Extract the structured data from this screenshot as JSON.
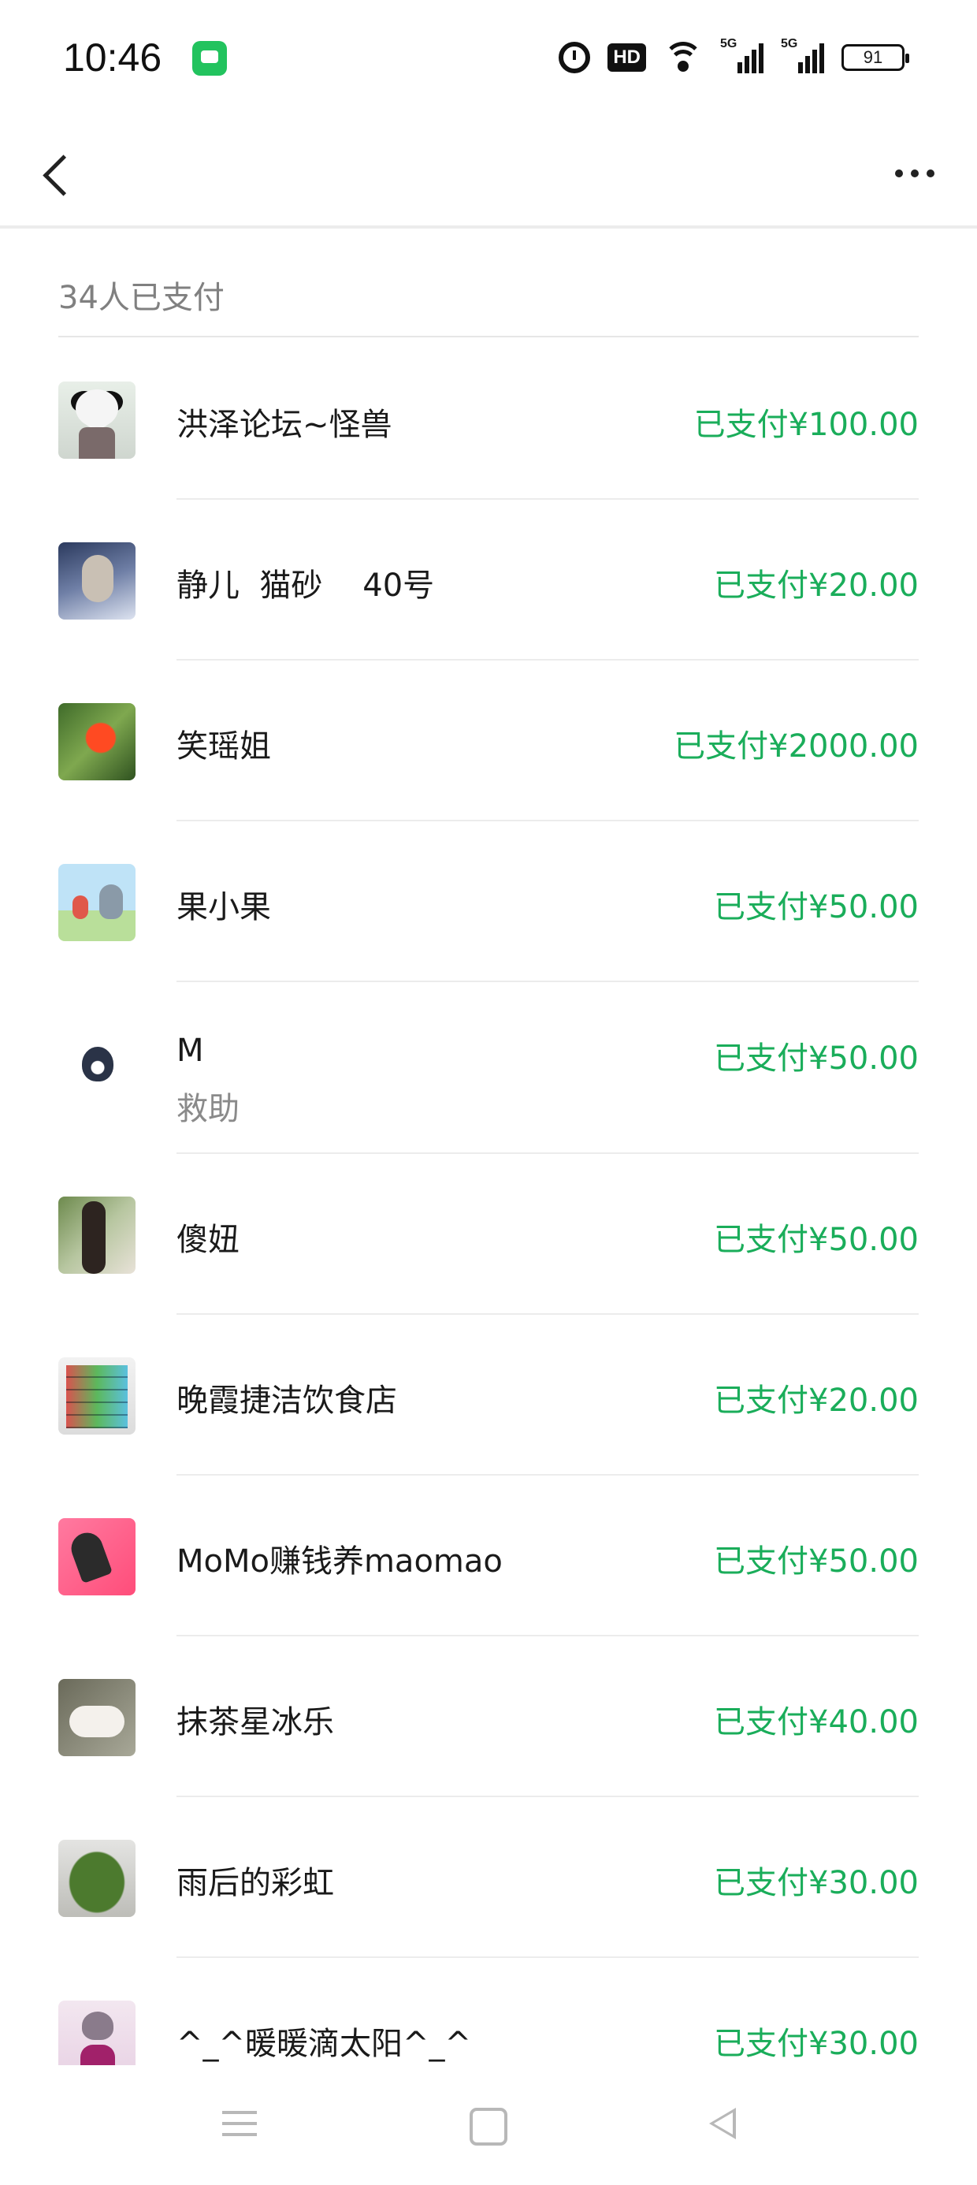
{
  "status_bar": {
    "time": "10:46",
    "icons": [
      "message-app-icon",
      "alarm-icon",
      "hd-icon",
      "wifi-icon",
      "signal-5g-icon",
      "signal-5g-icon",
      "battery-icon"
    ],
    "hd_label": "HD",
    "signal1_label": "5G",
    "signal2_label": "5G",
    "battery": "91"
  },
  "nav": {
    "back_icon": "chevron-left-icon",
    "more_icon": "more-horizontal-icon"
  },
  "summary": "34人已支付",
  "accent_color": "#1aad5a",
  "payers": [
    {
      "name": "洪泽论坛~怪兽",
      "amount": "已支付¥100.00",
      "avatar": "panda"
    },
    {
      "name": "静儿  猫砂    40号",
      "amount": "已支付¥20.00",
      "avatar": "cat"
    },
    {
      "name": "笑瑶姐",
      "amount": "已支付¥2000.00",
      "avatar": "flower"
    },
    {
      "name": "果小果",
      "amount": "已支付¥50.00",
      "avatar": "totoro"
    },
    {
      "name": "M",
      "note": "救助",
      "amount": "已支付¥50.00",
      "avatar": "husky"
    },
    {
      "name": "傻妞",
      "amount": "已支付¥50.00",
      "avatar": "girl"
    },
    {
      "name": "晚霞捷洁饮食店",
      "amount": "已支付¥20.00",
      "avatar": "shop"
    },
    {
      "name": "MoMo赚钱养maomao",
      "amount": "已支付¥50.00",
      "avatar": "momo"
    },
    {
      "name": "抹茶星冰乐",
      "amount": "已支付¥40.00",
      "avatar": "cat2"
    },
    {
      "name": "雨后的彩虹",
      "amount": "已支付¥30.00",
      "avatar": "moss"
    },
    {
      "name": "^_^暖暖滴太阳^_^",
      "amount": "已支付¥30.00",
      "avatar": "sun"
    }
  ],
  "system_nav": [
    "menu-icon",
    "home-icon",
    "back-triangle-icon"
  ]
}
